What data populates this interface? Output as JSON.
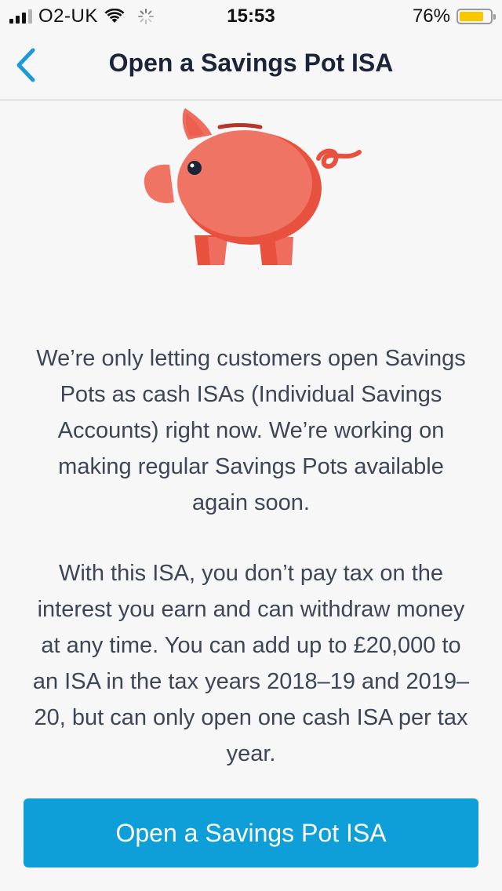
{
  "status_bar": {
    "carrier": "O2-UK",
    "time": "15:53",
    "battery": "76%",
    "battery_level": 0.76,
    "battery_color": "#f7c800"
  },
  "nav": {
    "back_icon": "chevron-left-icon",
    "title": "Open a Savings Pot ISA",
    "accent": "#1a9ad6"
  },
  "illustration": {
    "icon": "piggy-bank-icon",
    "color": "#ee6a5a"
  },
  "content": {
    "paragraph_1": "We’re only letting customers open Savings Pots as cash ISAs (Individual Savings Accounts) right now. We’re working on making regular Savings Pots available again soon.",
    "paragraph_2": "With this ISA, you don’t pay tax on the interest you earn and can withdraw money at any time. You can add up to £20,000 to an ISA in the tax years 2018–19 and 2019–20, but can only open one cash ISA per tax year."
  },
  "cta": {
    "label": "Open a Savings Pot ISA",
    "color": "#0e9fd8"
  }
}
